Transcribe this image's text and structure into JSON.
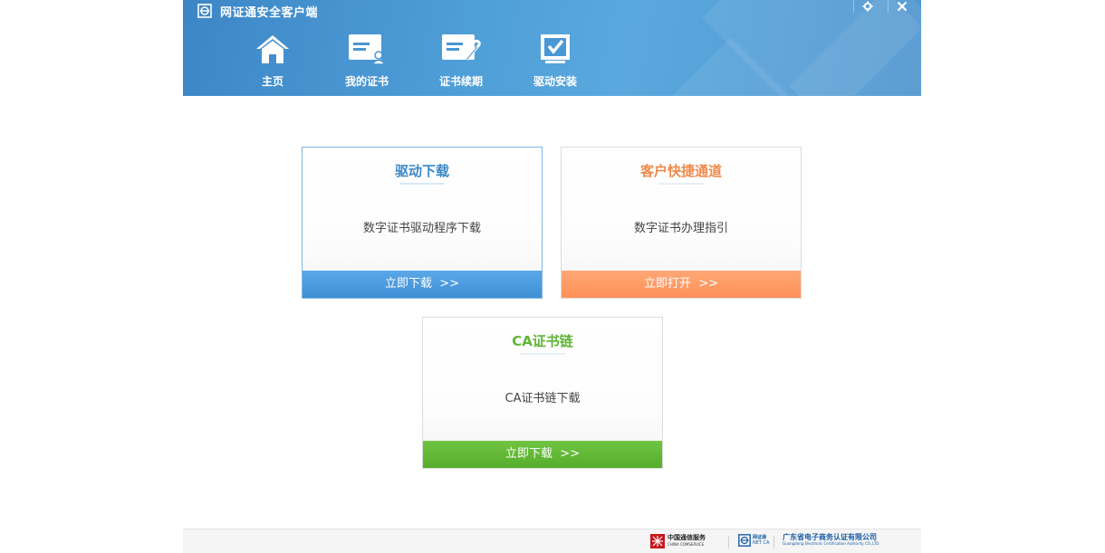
{
  "window": {
    "title": "网证通安全客户端",
    "title_icon": "netca-logo-icon",
    "controls": [
      {
        "name": "settings",
        "icon": "gear-icon"
      },
      {
        "name": "close",
        "icon": "close-icon"
      }
    ]
  },
  "nav": {
    "items": [
      {
        "label": "主页",
        "icon": "home-icon"
      },
      {
        "label": "我的证书",
        "icon": "certificate-user-icon"
      },
      {
        "label": "证书续期",
        "icon": "certificate-renew-icon"
      },
      {
        "label": "驱动安装",
        "icon": "checkbox-install-icon"
      }
    ]
  },
  "cards": [
    {
      "title": "驱动下载",
      "description": "数字证书驱动程序下载",
      "button": "立即下载  >>",
      "color": "#3a88c8",
      "button_color": "#4d9be0"
    },
    {
      "title": "客户快捷通道",
      "description": "数字证书办理指引",
      "button": "立即打开  >>",
      "color": "#f08a4b",
      "button_color": "#ff9a66"
    },
    {
      "title": "CA证书链",
      "description": "CA证书链下载",
      "button": "立即下载  >>",
      "color": "#5fb536",
      "button_color": "#62bb37"
    }
  ],
  "footer": {
    "logos": [
      {
        "text": "中国通信服务",
        "subtext": "CHINA COMSERVICE",
        "icon": "china-comservice-logo-icon"
      },
      {
        "text": "网证通",
        "subtext": "NET CA",
        "icon": "netca-logo-icon"
      },
      {
        "text": "广东省电子商务认证有限公司",
        "subtext": "Guangdong Electronic Certification Authority CO.,LTD"
      }
    ]
  },
  "colors": {
    "header": "#4a97d4",
    "blue": "#4d9be0",
    "orange": "#ff9a66",
    "green": "#62bb37"
  }
}
